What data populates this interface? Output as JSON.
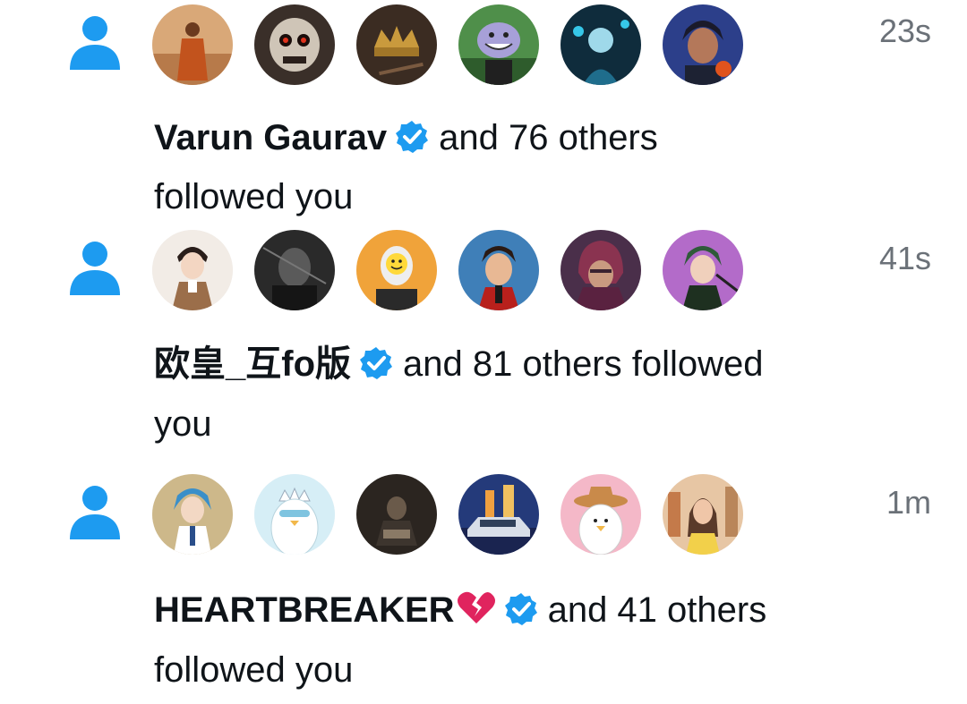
{
  "notifications": [
    {
      "time": "23s",
      "name": "Varun Gaurav",
      "rest_line1": "and 76 others",
      "line2": "followed you",
      "avatars": [
        "monk-avatar",
        "skull-avatar",
        "crown-avatar",
        "troll-avatar",
        "cyber-avatar",
        "anime-boy-avatar"
      ]
    },
    {
      "time": "41s",
      "name": "欧皇_互fo版",
      "rest_line1": "and 81 others followed",
      "line2": "you",
      "avatars": [
        "anime-soldier-avatar",
        "dark-photo-avatar",
        "smiley-avatar",
        "anime-boy-avatar",
        "magneto-avatar",
        "anime-girl-avatar"
      ]
    },
    {
      "time": "1m",
      "name": "HEARTBREAKER",
      "rest_line1": "and 41 others",
      "line2": "followed you",
      "avatars": [
        "anime-doctor-avatar",
        "penguin-crown-avatar",
        "dark-photo-avatar",
        "car-avatar",
        "penguin-cowboy-avatar",
        "woman-photo-avatar"
      ]
    }
  ],
  "colors": {
    "accent": "#1d9bf0",
    "muted": "#6b7178",
    "text": "#0f1419",
    "broken_heart": "#e0245e"
  }
}
